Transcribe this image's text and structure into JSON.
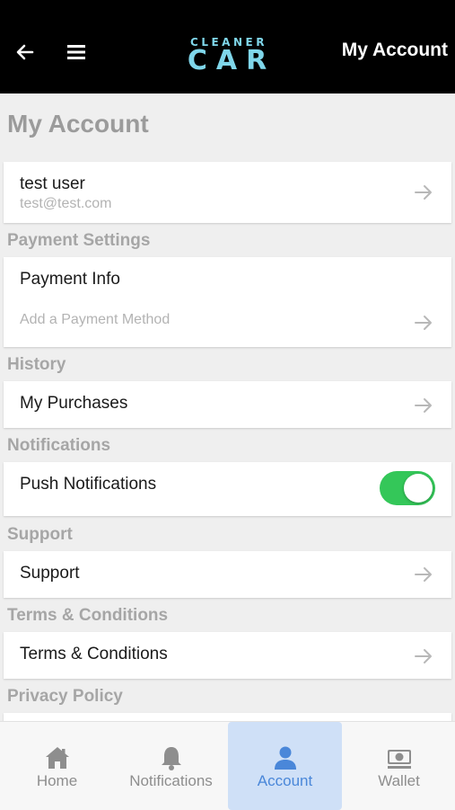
{
  "header": {
    "logo_line1": "CLEANER",
    "logo_line2": "CAR",
    "title": "My Account"
  },
  "page_title": "My Account",
  "profile": {
    "name": "test user",
    "email": "test@test.com"
  },
  "sections": {
    "payment": {
      "label": "Payment Settings",
      "item_title": "Payment Info",
      "item_subtitle": "Add a Payment Method"
    },
    "history": {
      "label": "History",
      "item_title": "My Purchases"
    },
    "notifications": {
      "label": "Notifications",
      "item_title": "Push Notifications",
      "toggle_on": true
    },
    "support": {
      "label": "Support",
      "item_title": "Support"
    },
    "terms": {
      "label": "Terms & Conditions",
      "item_title": "Terms & Conditions"
    },
    "privacy": {
      "label": "Privacy Policy"
    }
  },
  "tabbar": {
    "tabs": [
      {
        "label": "Home",
        "icon": "home-icon"
      },
      {
        "label": "Notifications",
        "icon": "bell-icon"
      },
      {
        "label": "Account",
        "icon": "user-icon",
        "active": true
      },
      {
        "label": "Wallet",
        "icon": "wallet-icon"
      }
    ]
  },
  "colors": {
    "accent": "#4a87d9",
    "toggle_on": "#34c759",
    "logo": "#7fd6ea"
  }
}
